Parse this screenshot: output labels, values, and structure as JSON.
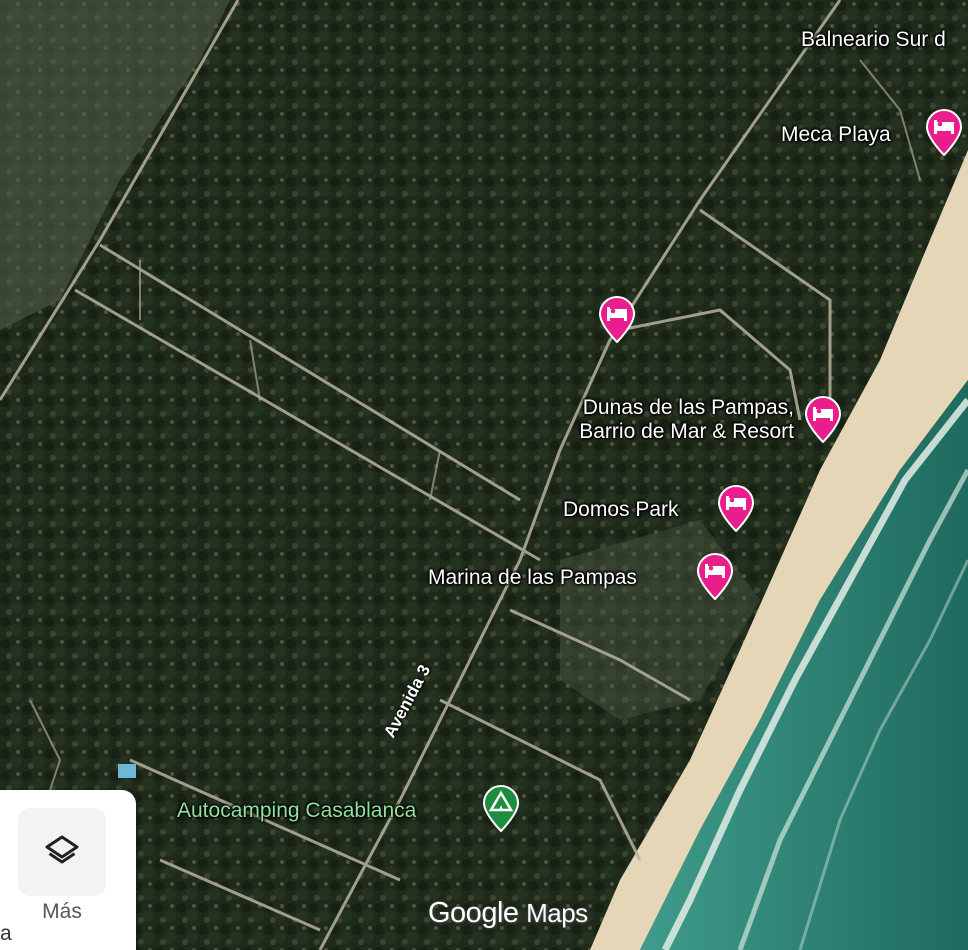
{
  "map": {
    "places": [
      {
        "name": "Balneario Sur d",
        "type": "area",
        "color": "#ffffff"
      },
      {
        "name": "Meca Playa",
        "type": "hotel",
        "color": "#ffffff"
      },
      {
        "name": "",
        "type": "hotel"
      },
      {
        "name_line1": "Dunas de las Pampas,",
        "name_line2": "Barrio de Mar & Resort",
        "type": "hotel"
      },
      {
        "name": "Domos Park",
        "type": "hotel"
      },
      {
        "name": "Marina de las Pampas",
        "type": "hotel"
      },
      {
        "name": "Autocamping Casablanca",
        "type": "camping",
        "color": "#8fe39a"
      }
    ],
    "road_label": "Avenida 3",
    "hotel_pin_color": "#e91e8c",
    "camping_pin_color": "#1e8e3e"
  },
  "controls": {
    "layers_label": "Más",
    "layers_icon": "layers-icon"
  },
  "branding": {
    "google": "Google",
    "maps": "Maps"
  },
  "edge_text": "a"
}
